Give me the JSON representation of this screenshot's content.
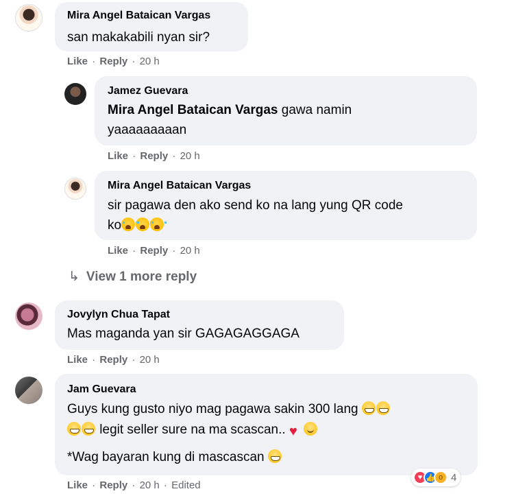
{
  "comments": [
    {
      "author": "Mira Angel Bataican Vargas",
      "text": "san makakabili nyan sir?",
      "actions": {
        "like": "Like",
        "reply": "Reply",
        "time": "20 h"
      }
    },
    {
      "author": "Jamez Guevara",
      "mention": "Mira Angel Bataican Vargas",
      "text_line1": " gawa namin",
      "text_line2": "yaaaaaaaaan",
      "actions": {
        "like": "Like",
        "reply": "Reply",
        "time": "20 h"
      }
    },
    {
      "author": "Mira Angel Bataican Vargas",
      "text_line1": "sir pagawa den ako send ko na lang yung QR code",
      "text_line2": "ko",
      "emoji": [
        "loudly-crying-face",
        "loudly-crying-face",
        "loudly-crying-face"
      ],
      "actions": {
        "like": "Like",
        "reply": "Reply",
        "time": "20 h"
      }
    },
    {
      "author": "Jovylyn Chua Tapat",
      "text": "Mas maganda yan sir GAGAGAGGAGA",
      "actions": {
        "like": "Like",
        "reply": "Reply",
        "time": "20 h"
      }
    },
    {
      "author": "Jam Guevara",
      "text_line1": "Guys kung gusto niyo mag pagawa sakin 300 lang",
      "text_line2": " legit seller sure na ma scascan..",
      "text_line3": "*Wag bayaran kung di mascascan",
      "emoji": [
        "grinning-face",
        "heart",
        "smiling-face"
      ],
      "actions": {
        "like": "Like",
        "reply": "Reply",
        "time": "20 h",
        "edited": "Edited"
      },
      "reactions": {
        "icons": [
          "love",
          "like",
          "wow"
        ],
        "count": "4"
      }
    }
  ],
  "view_more": {
    "label": "View 1 more reply",
    "icon": "reply-arrow-icon"
  },
  "colors": {
    "bubble": "#f0f2f5",
    "meta": "#65676b",
    "text": "#050505",
    "like": "#1877f2",
    "love": "#f33e58"
  }
}
